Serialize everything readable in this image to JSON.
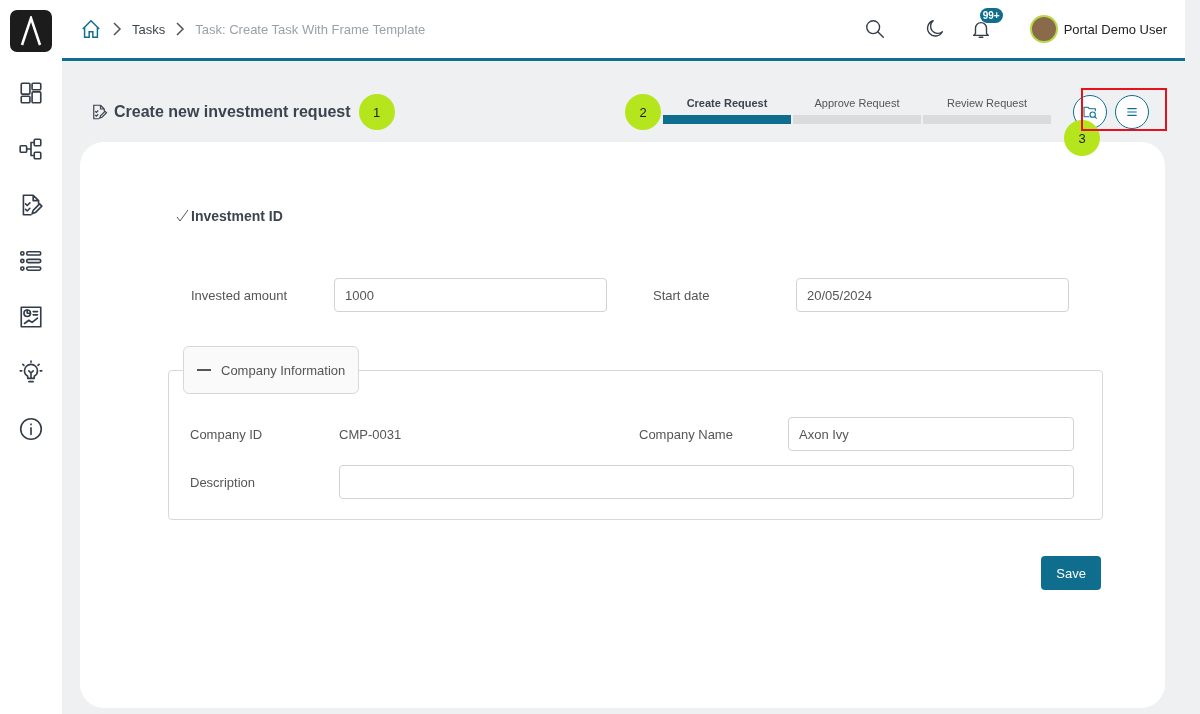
{
  "breadcrumb": [
    {
      "label": "Tasks",
      "current": false
    },
    {
      "label": "Task: Create Task With Frame Template",
      "current": true
    }
  ],
  "header": {
    "notification_count": "99+",
    "user_name": "Portal Demo User"
  },
  "page_title": "Create new investment request",
  "steps": [
    {
      "label": "Create Request",
      "selected": true
    },
    {
      "label": "Approve Request",
      "selected": false
    },
    {
      "label": "Review Request",
      "selected": false
    }
  ],
  "form": {
    "section_title": "Investment ID",
    "invested_amount": {
      "label": "Invested amount",
      "value": "1000"
    },
    "start_date": {
      "label": "Start date",
      "value": "20/05/2024"
    },
    "company_panel": {
      "legend": "Company Information",
      "expanded": true,
      "company_id": {
        "label": "Company ID",
        "value": "CMP-0031"
      },
      "company_name": {
        "label": "Company Name",
        "value": "Axon Ivy"
      },
      "description": {
        "label": "Description"
      }
    },
    "save_button": "Save"
  },
  "annotations": [
    "1",
    "2",
    "3"
  ]
}
